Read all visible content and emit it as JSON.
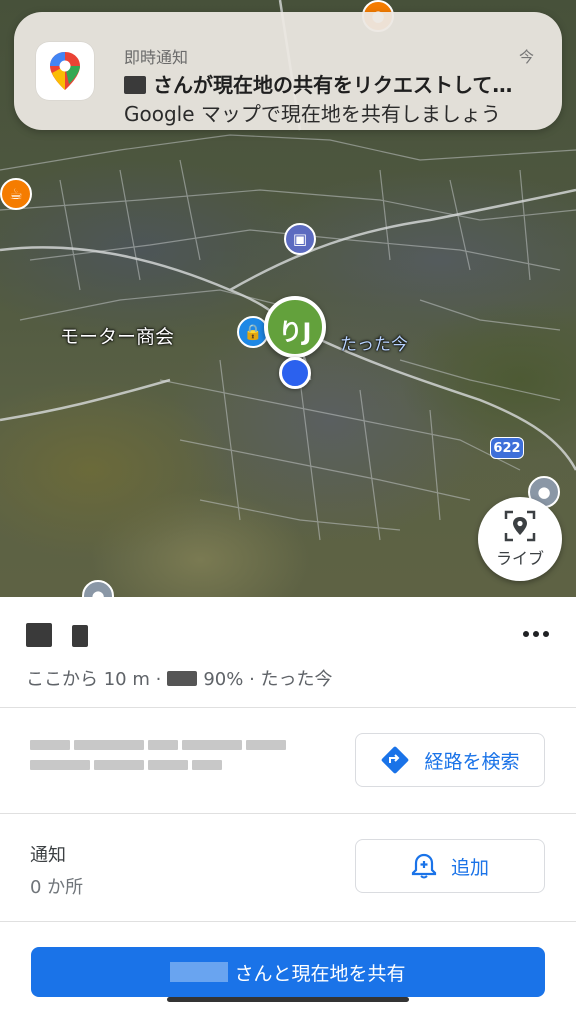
{
  "notification": {
    "app_name": "即時通知",
    "time": "今",
    "title": "さんが現在地の共有をリクエストして…",
    "body": "Google マップで現在地を共有しましょう",
    "app_icon": "google-maps-icon"
  },
  "map": {
    "labels": {
      "business": "モーター商会",
      "updated": "たった今",
      "route_number": "622"
    },
    "avatar_initial": "りJ",
    "live_button_label": "ライブ",
    "live_icon": "live-view-location-icon"
  },
  "sheet": {
    "person_name": "",
    "distance": "ここから 10 m ·",
    "battery": "90%",
    "updated": "· たった今",
    "directions_button": "経路を検索",
    "notifications_label": "通知",
    "notifications_count": "0 か所",
    "add_button": "追加",
    "share_button": "さんと現在地を共有"
  },
  "colors": {
    "accent": "#1a73e8",
    "user_marker": "#63a13c",
    "self_marker": "#2b61ee"
  }
}
